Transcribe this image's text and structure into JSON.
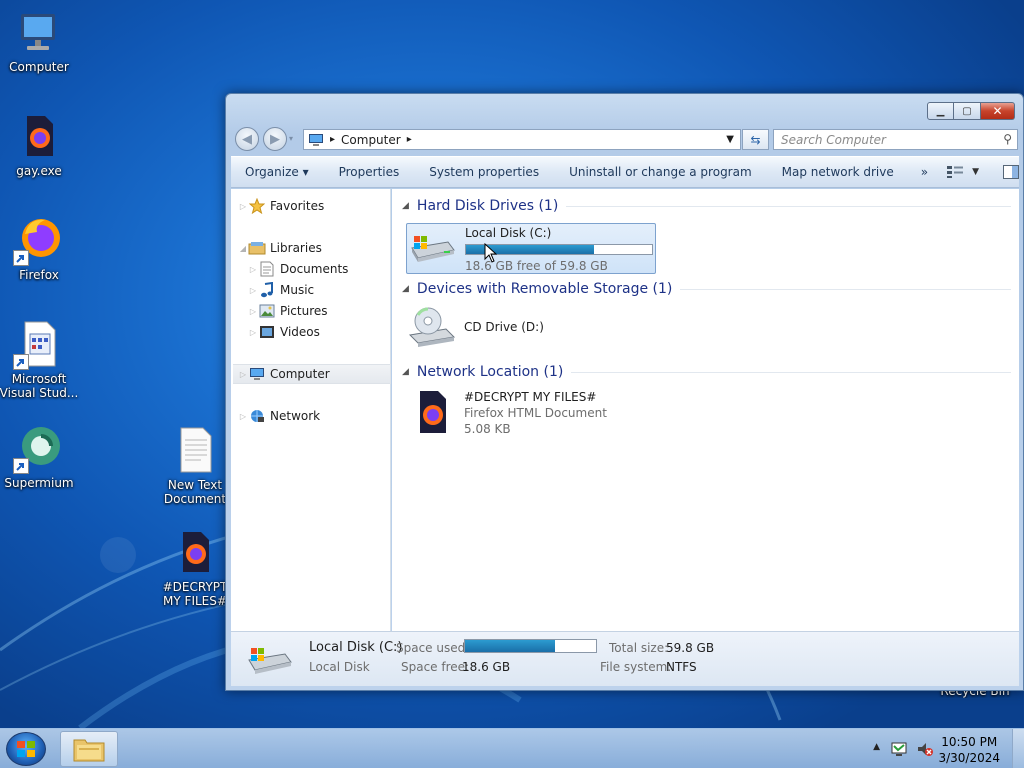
{
  "desktop": {
    "icons": [
      {
        "label": "Computer"
      },
      {
        "label": "gay.exe"
      },
      {
        "label": "Firefox"
      },
      {
        "label": "Microsoft Visual Stud..."
      },
      {
        "label": "Supermium"
      },
      {
        "label": "New Text Document"
      },
      {
        "label": "#DECRYPT MY FILES#"
      },
      {
        "label": "Recycle Bin"
      }
    ]
  },
  "window": {
    "address": {
      "root_sep": "▸",
      "location": "Computer",
      "trail_sep": "▸"
    },
    "search": {
      "placeholder": "Search Computer"
    },
    "commands": [
      "Organize ▾",
      "Properties",
      "System properties",
      "Uninstall or change a program",
      "Map network drive",
      "»"
    ],
    "nav": {
      "favorites": "Favorites",
      "libraries": "Libraries",
      "documents": "Documents",
      "music": "Music",
      "pictures": "Pictures",
      "videos": "Videos",
      "computer": "Computer",
      "network": "Network"
    },
    "groups": {
      "hdd": "Hard Disk Drives (1)",
      "removable": "Devices with Removable Storage (1)",
      "network": "Network Location (1)"
    },
    "local_disk": {
      "name": "Local Disk (C:)",
      "free_text": "18.6 GB free of 59.8 GB",
      "used_fraction": 0.69
    },
    "cd_drive": {
      "name": "CD Drive (D:)"
    },
    "net_file": {
      "name": "#DECRYPT MY FILES#",
      "type": "Firefox HTML Document",
      "size": "5.08 KB"
    },
    "details": {
      "name": "Local Disk (C:)",
      "kind": "Local Disk",
      "space_used_label": "Space used:",
      "space_free_label": "Space free:",
      "space_free": "18.6 GB",
      "total_label": "Total size:",
      "total": "59.8 GB",
      "fs_label": "File system:",
      "fs": "NTFS"
    }
  },
  "taskbar": {
    "time": "10:50 PM",
    "date": "3/30/2024"
  },
  "colors": {
    "accent": "#1e3287",
    "bar": "#1a6fa8"
  }
}
